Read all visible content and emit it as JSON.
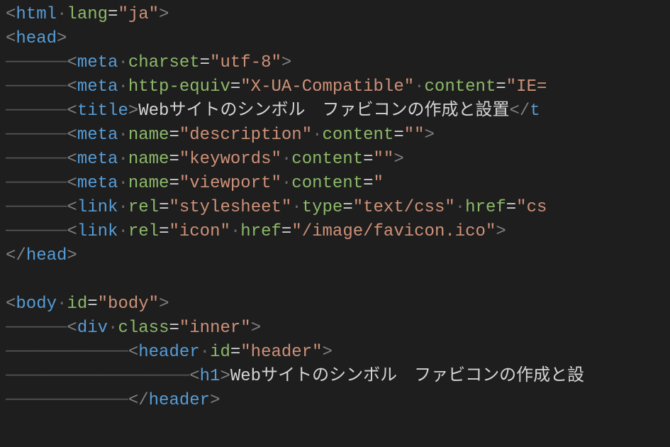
{
  "code": {
    "lines": [
      {
        "indent": 0,
        "tokens": [
          {
            "t": "bracket",
            "v": "<"
          },
          {
            "t": "tag",
            "v": "html"
          },
          {
            "t": "dot",
            "v": "·"
          },
          {
            "t": "attr-green",
            "v": "lang"
          },
          {
            "t": "eq",
            "v": "="
          },
          {
            "t": "str",
            "v": "\"ja\""
          },
          {
            "t": "bracket",
            "v": ">"
          }
        ]
      },
      {
        "indent": 0,
        "tokens": [
          {
            "t": "bracket",
            "v": "<"
          },
          {
            "t": "tag",
            "v": "head"
          },
          {
            "t": "bracket",
            "v": ">"
          }
        ]
      },
      {
        "indent": 1,
        "tokens": [
          {
            "t": "bracket",
            "v": "<"
          },
          {
            "t": "tag",
            "v": "meta"
          },
          {
            "t": "dot",
            "v": "·"
          },
          {
            "t": "attr-green",
            "v": "charset"
          },
          {
            "t": "eq",
            "v": "="
          },
          {
            "t": "str",
            "v": "\"utf-8\""
          },
          {
            "t": "bracket",
            "v": ">"
          }
        ]
      },
      {
        "indent": 1,
        "tokens": [
          {
            "t": "bracket",
            "v": "<"
          },
          {
            "t": "tag",
            "v": "meta"
          },
          {
            "t": "dot",
            "v": "·"
          },
          {
            "t": "attr-green",
            "v": "http-equiv"
          },
          {
            "t": "eq",
            "v": "="
          },
          {
            "t": "str",
            "v": "\"X-UA-Compatible\""
          },
          {
            "t": "dot",
            "v": "·"
          },
          {
            "t": "attr-green",
            "v": "content"
          },
          {
            "t": "eq",
            "v": "="
          },
          {
            "t": "str",
            "v": "\"IE="
          }
        ]
      },
      {
        "indent": 1,
        "tokens": [
          {
            "t": "bracket",
            "v": "<"
          },
          {
            "t": "tag",
            "v": "title"
          },
          {
            "t": "bracket",
            "v": ">"
          },
          {
            "t": "txt",
            "v": "Webサイトのシンボル　ファビコンの作成と設置"
          },
          {
            "t": "bracket",
            "v": "</"
          },
          {
            "t": "tag",
            "v": "t"
          }
        ]
      },
      {
        "indent": 1,
        "tokens": [
          {
            "t": "bracket",
            "v": "<"
          },
          {
            "t": "tag",
            "v": "meta"
          },
          {
            "t": "dot",
            "v": "·"
          },
          {
            "t": "attr-green",
            "v": "name"
          },
          {
            "t": "eq",
            "v": "="
          },
          {
            "t": "str",
            "v": "\"description\""
          },
          {
            "t": "dot",
            "v": "·"
          },
          {
            "t": "attr-green",
            "v": "content"
          },
          {
            "t": "eq",
            "v": "="
          },
          {
            "t": "str",
            "v": "\"\""
          },
          {
            "t": "bracket",
            "v": ">"
          }
        ]
      },
      {
        "indent": 1,
        "tokens": [
          {
            "t": "bracket",
            "v": "<"
          },
          {
            "t": "tag",
            "v": "meta"
          },
          {
            "t": "dot",
            "v": "·"
          },
          {
            "t": "attr-green",
            "v": "name"
          },
          {
            "t": "eq",
            "v": "="
          },
          {
            "t": "str",
            "v": "\"keywords\""
          },
          {
            "t": "dot",
            "v": "·"
          },
          {
            "t": "attr-green",
            "v": "content"
          },
          {
            "t": "eq",
            "v": "="
          },
          {
            "t": "str",
            "v": "\"\""
          },
          {
            "t": "bracket",
            "v": ">"
          }
        ]
      },
      {
        "indent": 1,
        "tokens": [
          {
            "t": "bracket",
            "v": "<"
          },
          {
            "t": "tag",
            "v": "meta"
          },
          {
            "t": "dot",
            "v": "·"
          },
          {
            "t": "attr-green",
            "v": "name"
          },
          {
            "t": "eq",
            "v": "="
          },
          {
            "t": "str",
            "v": "\"viewport\""
          },
          {
            "t": "dot",
            "v": "·"
          },
          {
            "t": "attr-green",
            "v": "content"
          },
          {
            "t": "eq",
            "v": "="
          },
          {
            "t": "str",
            "v": "\""
          }
        ]
      },
      {
        "indent": 1,
        "tokens": [
          {
            "t": "bracket",
            "v": "<"
          },
          {
            "t": "tag",
            "v": "link"
          },
          {
            "t": "dot",
            "v": "·"
          },
          {
            "t": "attr-green",
            "v": "rel"
          },
          {
            "t": "eq",
            "v": "="
          },
          {
            "t": "str",
            "v": "\"stylesheet\""
          },
          {
            "t": "dot",
            "v": "·"
          },
          {
            "t": "attr-green",
            "v": "type"
          },
          {
            "t": "eq",
            "v": "="
          },
          {
            "t": "str",
            "v": "\"text/css\""
          },
          {
            "t": "dot",
            "v": "·"
          },
          {
            "t": "attr-green",
            "v": "href"
          },
          {
            "t": "eq",
            "v": "="
          },
          {
            "t": "str",
            "v": "\"cs"
          }
        ]
      },
      {
        "indent": 1,
        "tokens": [
          {
            "t": "bracket",
            "v": "<"
          },
          {
            "t": "tag",
            "v": "link"
          },
          {
            "t": "dot",
            "v": "·"
          },
          {
            "t": "attr-green",
            "v": "rel"
          },
          {
            "t": "eq",
            "v": "="
          },
          {
            "t": "str",
            "v": "\"icon\""
          },
          {
            "t": "dot",
            "v": "·"
          },
          {
            "t": "attr-green",
            "v": "href"
          },
          {
            "t": "eq",
            "v": "="
          },
          {
            "t": "str",
            "v": "\"/image/favicon.ico\""
          },
          {
            "t": "bracket",
            "v": ">"
          }
        ]
      },
      {
        "indent": 0,
        "tokens": [
          {
            "t": "bracket",
            "v": "</"
          },
          {
            "t": "tag",
            "v": "head"
          },
          {
            "t": "bracket",
            "v": ">"
          }
        ]
      },
      {
        "indent": 0,
        "tokens": []
      },
      {
        "indent": 0,
        "tokens": [
          {
            "t": "bracket",
            "v": "<"
          },
          {
            "t": "tag",
            "v": "body"
          },
          {
            "t": "dot",
            "v": "·"
          },
          {
            "t": "attr-green",
            "v": "id"
          },
          {
            "t": "eq",
            "v": "="
          },
          {
            "t": "str",
            "v": "\"body\""
          },
          {
            "t": "bracket",
            "v": ">"
          }
        ]
      },
      {
        "indent": 1,
        "tokens": [
          {
            "t": "bracket",
            "v": "<"
          },
          {
            "t": "tag",
            "v": "div"
          },
          {
            "t": "dot",
            "v": "·"
          },
          {
            "t": "attr-green",
            "v": "class"
          },
          {
            "t": "eq",
            "v": "="
          },
          {
            "t": "str",
            "v": "\"inner\""
          },
          {
            "t": "bracket",
            "v": ">"
          }
        ]
      },
      {
        "indent": 2,
        "tokens": [
          {
            "t": "bracket",
            "v": "<"
          },
          {
            "t": "tag",
            "v": "header"
          },
          {
            "t": "dot",
            "v": "·"
          },
          {
            "t": "attr-green",
            "v": "id"
          },
          {
            "t": "eq",
            "v": "="
          },
          {
            "t": "str",
            "v": "\"header\""
          },
          {
            "t": "bracket",
            "v": ">"
          }
        ]
      },
      {
        "indent": 3,
        "tokens": [
          {
            "t": "bracket",
            "v": "<"
          },
          {
            "t": "tag",
            "v": "h1"
          },
          {
            "t": "bracket",
            "v": ">"
          },
          {
            "t": "txt",
            "v": "Webサイトのシンボル　ファビコンの作成と設"
          }
        ]
      },
      {
        "indent": 2,
        "tokens": [
          {
            "t": "bracket",
            "v": "</"
          },
          {
            "t": "tag",
            "v": "header"
          },
          {
            "t": "bracket",
            "v": ">"
          }
        ]
      }
    ]
  }
}
